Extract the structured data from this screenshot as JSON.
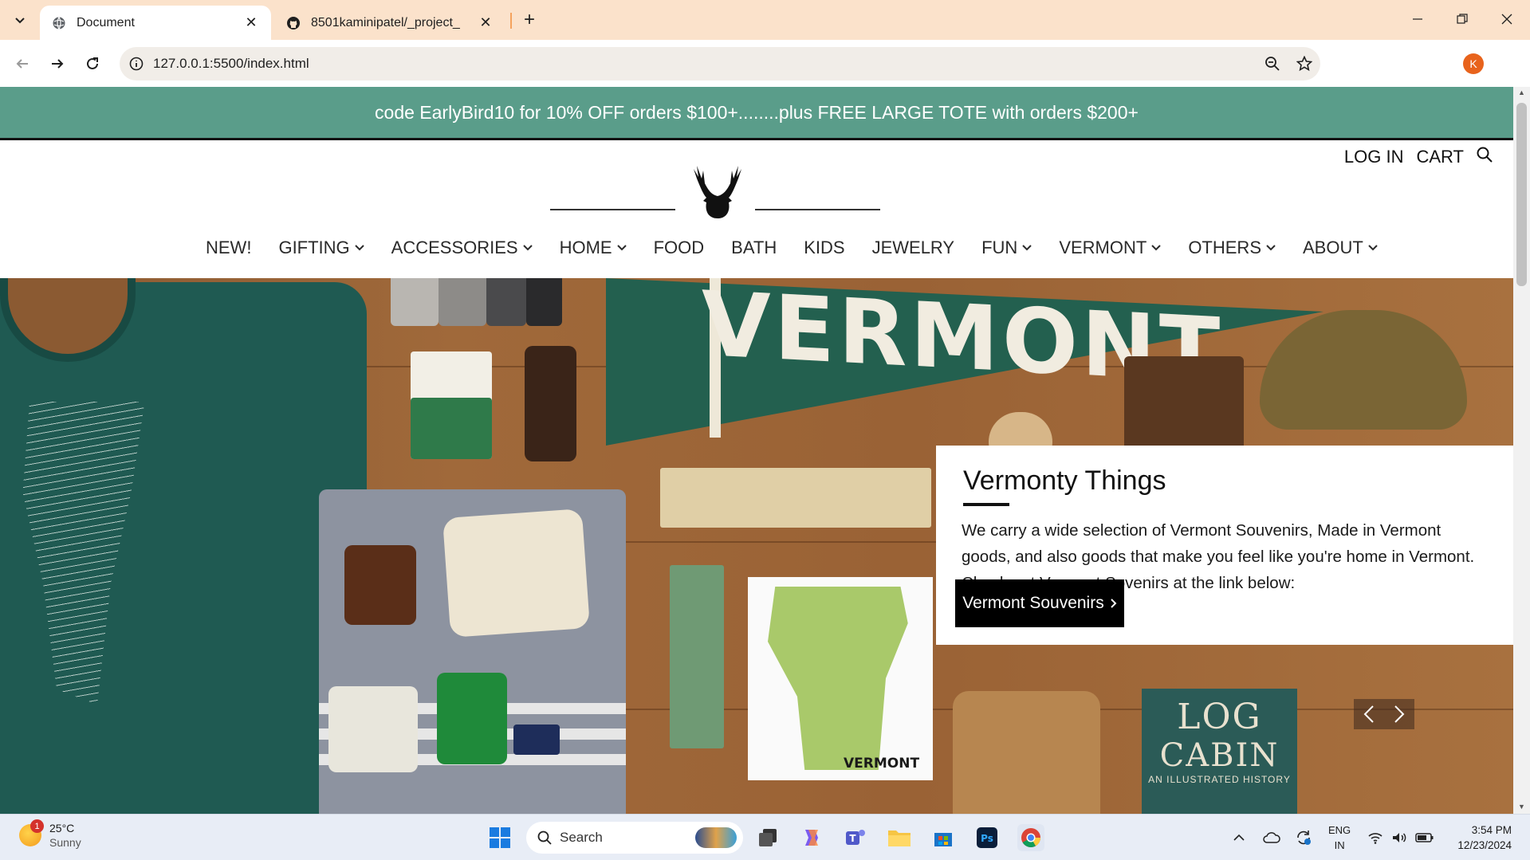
{
  "browser": {
    "tabs": [
      {
        "title": "Document",
        "active": true,
        "icon": "globe-icon"
      },
      {
        "title": "8501kaminipatel/_project_",
        "active": false,
        "icon": "github-icon"
      }
    ],
    "url": "127.0.0.1:5500/index.html",
    "profile_initial": "K"
  },
  "site": {
    "promo": "code EarlyBird10 for 10% OFF orders $100+........plus FREE LARGE TOTE with orders $200+",
    "util": {
      "login": "LOG IN",
      "cart": "CART"
    },
    "nav": [
      {
        "label": "NEW!",
        "dropdown": false
      },
      {
        "label": "GIFTING",
        "dropdown": true
      },
      {
        "label": "ACCESSORIES",
        "dropdown": true
      },
      {
        "label": "HOME",
        "dropdown": true
      },
      {
        "label": "FOOD",
        "dropdown": false
      },
      {
        "label": "BATH",
        "dropdown": false
      },
      {
        "label": "KIDS",
        "dropdown": false
      },
      {
        "label": "JEWELRY",
        "dropdown": false
      },
      {
        "label": "FUN",
        "dropdown": true
      },
      {
        "label": "VERMONT",
        "dropdown": true
      },
      {
        "label": "OTHERS",
        "dropdown": true
      },
      {
        "label": "ABOUT",
        "dropdown": true
      }
    ],
    "hero": {
      "pennant_text": "VERMONT",
      "map_label": "VERMONT",
      "book": {
        "line1": "LOG",
        "line2": "CABIN",
        "line3": "AN ILLUSTRATED HISTORY"
      },
      "feature_title": "Vermonty Things",
      "feature_body": "We carry a wide selection of Vermont Souvenirs, Made in Vermont goods, and also goods that make you feel like you're home in Vermont. Check out Vermont Sovenirs at the link below:",
      "cta": "Vermont Souvenirs"
    }
  },
  "taskbar": {
    "weather": {
      "temp": "25°C",
      "condition": "Sunny",
      "badge": "1"
    },
    "search_placeholder": "Search",
    "lang": {
      "line1": "ENG",
      "line2": "IN"
    },
    "time": "3:54 PM",
    "date": "12/23/2024"
  },
  "colors": {
    "promo_bg": "#5a9d8a",
    "tabbar_bg": "#fbe2cb",
    "cta_bg": "#000000",
    "taskbar_bg": "#e8edf6"
  }
}
